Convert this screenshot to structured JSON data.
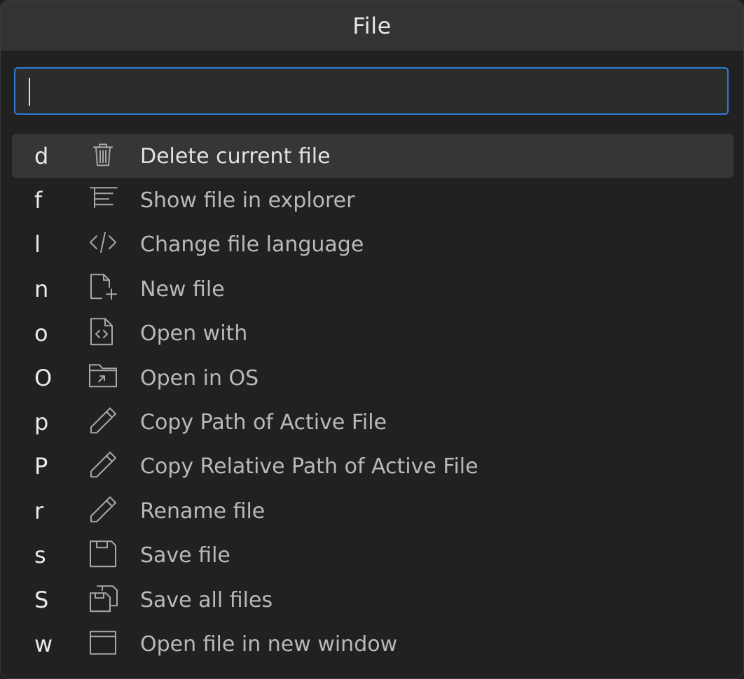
{
  "window": {
    "title": "File"
  },
  "search": {
    "value": "",
    "placeholder": ""
  },
  "items": [
    {
      "key": "d",
      "label": "Delete current file",
      "icon": "trash-icon",
      "selected": true
    },
    {
      "key": "f",
      "label": "Show file in explorer",
      "icon": "tree-icon",
      "selected": false
    },
    {
      "key": "l",
      "label": "Change file language",
      "icon": "code-icon",
      "selected": false
    },
    {
      "key": "n",
      "label": "New file",
      "icon": "new-file-icon",
      "selected": false
    },
    {
      "key": "o",
      "label": "Open with",
      "icon": "file-code-icon",
      "selected": false
    },
    {
      "key": "O",
      "label": "Open in OS",
      "icon": "folder-open-icon",
      "selected": false
    },
    {
      "key": "p",
      "label": "Copy Path of Active File",
      "icon": "pencil-icon",
      "selected": false
    },
    {
      "key": "P",
      "label": "Copy Relative Path of Active File",
      "icon": "pencil-icon",
      "selected": false
    },
    {
      "key": "r",
      "label": "Rename file",
      "icon": "pencil-icon",
      "selected": false
    },
    {
      "key": "s",
      "label": "Save file",
      "icon": "save-icon",
      "selected": false
    },
    {
      "key": "S",
      "label": "Save all files",
      "icon": "save-all-icon",
      "selected": false
    },
    {
      "key": "w",
      "label": "Open file in new window",
      "icon": "window-icon",
      "selected": false
    }
  ],
  "colors": {
    "background": "#212121",
    "titlebar": "#333333",
    "focus_border": "#2f7bd4",
    "selected_row": "#363636",
    "icon_stroke": "#a8a8a8"
  }
}
